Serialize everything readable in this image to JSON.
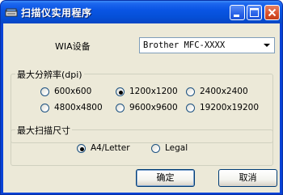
{
  "window": {
    "title": "扫描仪实用程序"
  },
  "wia": {
    "label": "WIA设备",
    "selected": "Brother MFC-XXXX"
  },
  "resolution": {
    "title": "最大分辨率(dpi)",
    "options": [
      "600x600",
      "1200x1200",
      "2400x2400",
      "4800x4800",
      "9600x9600",
      "19200x19200"
    ],
    "selected": "1200x1200"
  },
  "scan_size": {
    "title": "最大扫描尺寸",
    "options": [
      "A4/Letter",
      "Legal"
    ],
    "selected": "A4/Letter"
  },
  "buttons": {
    "ok": "确定",
    "cancel": "取消"
  },
  "colors": {
    "titlebar": "#0a55e4",
    "client_bg": "#ece9d8",
    "close_button": "#d8502b"
  },
  "icons": {
    "app": "scanner-icon",
    "minimize": "minimize-icon",
    "maximize": "maximize-icon",
    "close": "close-icon",
    "dropdown": "chevron-down-icon"
  }
}
